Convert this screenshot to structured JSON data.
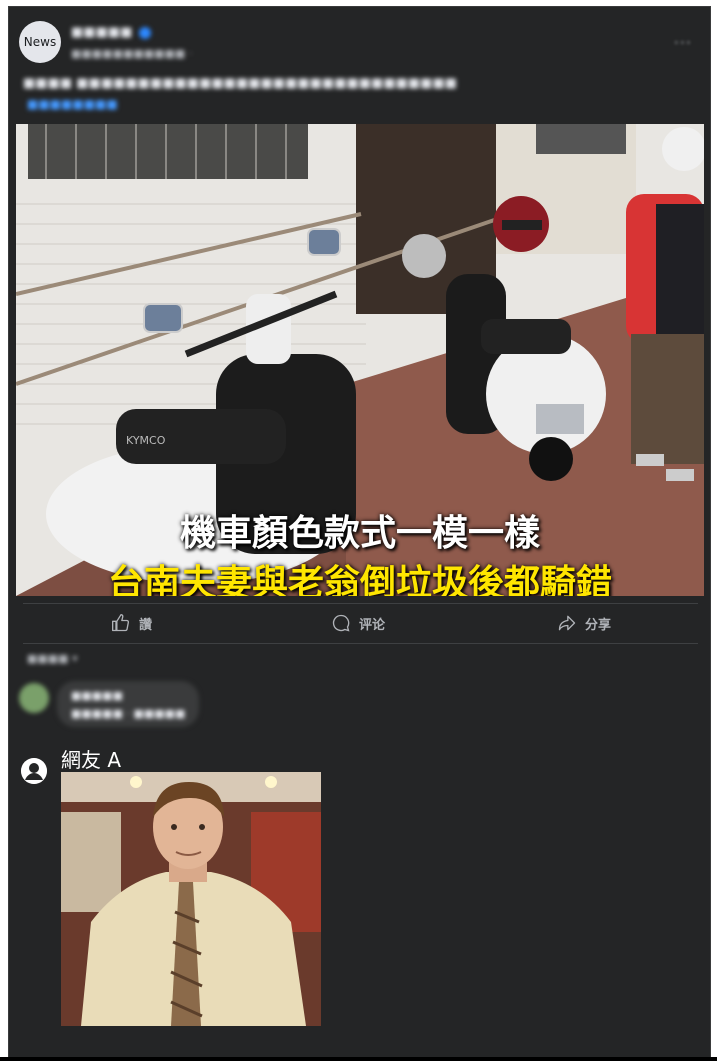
{
  "post": {
    "avatar_label": "News",
    "page_name": "■■■■■",
    "meta": "■■■■■■■■■■■ ·",
    "more_menu": "···",
    "caption_line1": "■■■■ ■■■■■■■■■■■■■■■■■■■■■■■■■■■■■■■",
    "caption_line2": "■■■■■■■■"
  },
  "photo": {
    "overlay_line1": "機車顏色款式一模一樣",
    "overlay_line2": "台南夫妻與老翁倒垃圾後都騎錯",
    "overlay_line1_color": "#ffffff",
    "overlay_line2_color": "#ffe600",
    "scooter_brand_text": "KYMCO"
  },
  "actions": {
    "like_label": "讚",
    "comment_label": "评论",
    "share_label": "分享"
  },
  "comments": {
    "sort_label": "■■■■ ▾",
    "first_comment": {
      "name": "■■■■■",
      "text": "■■■■■ · ■■■■■"
    },
    "reply": {
      "name": "網友 A"
    }
  },
  "colors": {
    "background": "#242526",
    "text_primary": "#e4e6eb",
    "text_secondary": "#b0b3b8",
    "link": "#4599ff"
  }
}
